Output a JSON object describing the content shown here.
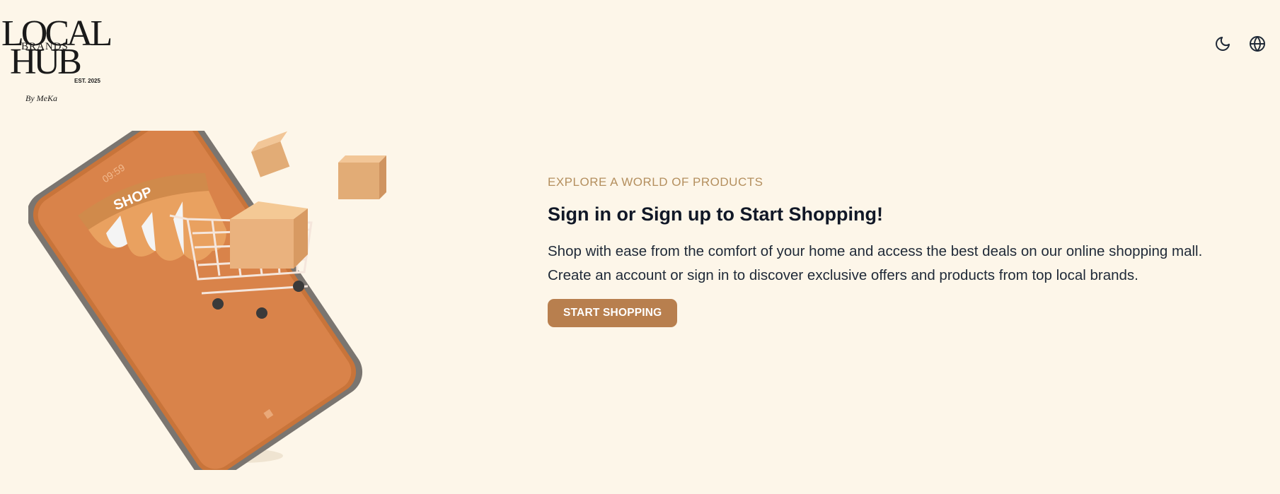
{
  "logo": {
    "line1": "LOCAL",
    "line2": "BRANDS",
    "line3": "HUB",
    "est": "EST. 2025",
    "byline": "By MeKa"
  },
  "header": {
    "theme_toggle_icon": "moon-icon",
    "language_icon": "globe-icon"
  },
  "hero": {
    "eyebrow": "EXPLORE A WORLD OF PRODUCTS",
    "headline": "Sign in or Sign up to Start Shopping!",
    "description_line1": "Shop with ease from the comfort of your home and access the best deals on our online shopping mall.",
    "description_line2": "Create an account or sign in to discover exclusive offers and products from top local brands.",
    "cta_label": "START SHOPPING"
  },
  "illustration": {
    "shop_sign": "SHOP",
    "phone_time": "09:59"
  },
  "colors": {
    "background": "#fdf6e9",
    "accent": "#b87f4e",
    "eyebrow": "#b48f5e",
    "heading": "#111827"
  }
}
